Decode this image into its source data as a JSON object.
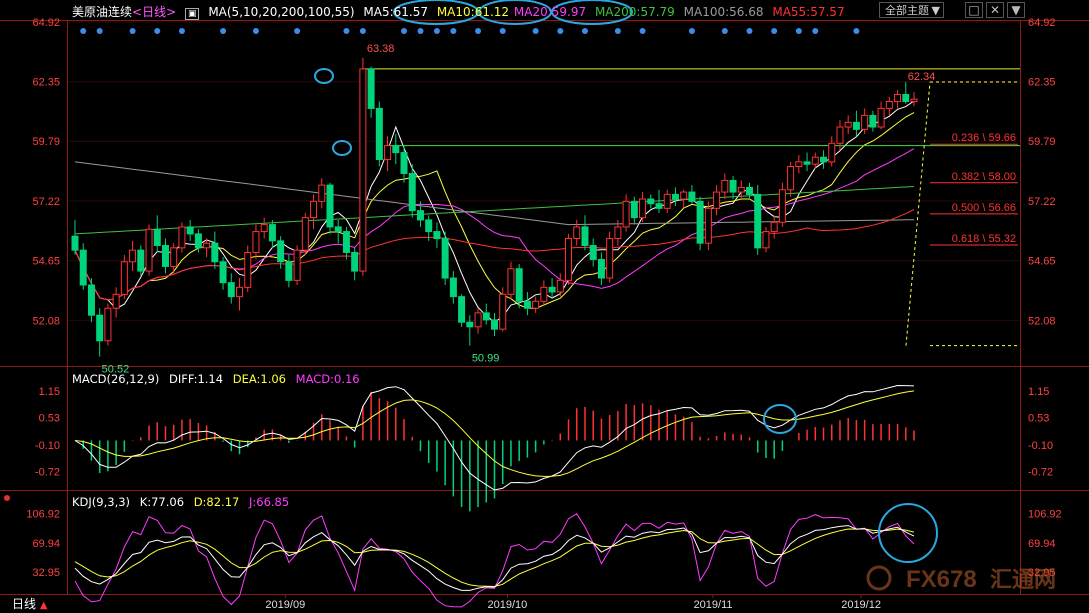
{
  "main_header": {
    "name": "美原油连续",
    "period": "<日线>",
    "ma_params": "MA(5,10,20,200,100,55)",
    "ma5": "MA5:61.57",
    "ma10": "MA10:61.12",
    "ma20": "MA20:59.97",
    "ma200": "MA200:57.79",
    "ma100": "MA100:56.68",
    "ma55": "MA55:57.57"
  },
  "toolbar": {
    "theme_label": "全部主题",
    "theme_arrow": "▼",
    "square_icon": "□",
    "close_icon": "✕",
    "dropdown_icon": "▼"
  },
  "price_axis": [
    "64.92",
    "62.35",
    "59.79",
    "57.22",
    "54.65",
    "52.08"
  ],
  "annotations": {
    "high": "63.38",
    "low1": "50.52",
    "low2": "50.99",
    "recent_high": "62.34"
  },
  "fib_levels": [
    {
      "label": "0.236 \\ 59.66",
      "price": 59.66
    },
    {
      "label": "0.382 \\ 58.00",
      "price": 58.0
    },
    {
      "label": "0.500 \\ 56.66",
      "price": 56.66
    },
    {
      "label": "0.618 \\ 55.32",
      "price": 55.32
    }
  ],
  "macd_header": {
    "params": "MACD(26,12,9)",
    "diff": "DIFF:1.14",
    "dea": "DEA:1.06",
    "macd": "MACD:0.16"
  },
  "macd_axis": [
    "1.15",
    "0.53",
    "-0.10",
    "-0.72"
  ],
  "kdj_header": {
    "params": "KDJ(9,3,3)",
    "k": "K:77.06",
    "d": "D:82.17",
    "j": "J:66.85"
  },
  "kdj_axis": [
    "106.92",
    "69.94",
    "32.95"
  ],
  "date_axis": [
    "2019/09",
    "2019/10",
    "2019/11",
    "2019/12"
  ],
  "bottom_tab": {
    "label": "日线",
    "arrow": "▲"
  },
  "watermark": {
    "text": "FX678",
    "sub": "汇通网"
  },
  "colors": {
    "up": "#ff3232",
    "down": "#00d47a",
    "ma5": "#ffffff",
    "ma10": "#ffff3c",
    "ma20": "#ff3cff",
    "ma200": "#40c040",
    "ma100": "#9a9a9a",
    "ma55": "#ff3232",
    "circle": "#29a8e0"
  },
  "chart_data": {
    "type": "candlestick",
    "title": "美原油连续 <日线>",
    "ylim": [
      50.2,
      64.92
    ],
    "ohlc": [
      [
        55.7,
        56.4,
        54.9,
        55.1
      ],
      [
        55.1,
        55.4,
        53.4,
        53.6
      ],
      [
        53.6,
        53.9,
        52.0,
        52.3
      ],
      [
        52.3,
        52.6,
        50.52,
        51.2
      ],
      [
        51.2,
        52.8,
        51.0,
        52.6
      ],
      [
        52.6,
        53.5,
        52.2,
        53.2
      ],
      [
        53.2,
        54.9,
        53.0,
        54.6
      ],
      [
        54.6,
        55.5,
        54.2,
        55.1
      ],
      [
        55.1,
        55.3,
        54.0,
        54.2
      ],
      [
        54.2,
        56.2,
        54.0,
        56.0
      ],
      [
        56.0,
        56.6,
        55.0,
        55.3
      ],
      [
        55.3,
        55.6,
        54.1,
        54.4
      ],
      [
        54.4,
        55.4,
        54.1,
        55.2
      ],
      [
        55.2,
        56.3,
        55.0,
        56.1
      ],
      [
        56.1,
        56.4,
        55.5,
        55.8
      ],
      [
        55.8,
        56.0,
        55.0,
        55.2
      ],
      [
        55.2,
        55.6,
        54.8,
        55.4
      ],
      [
        55.4,
        55.9,
        54.3,
        54.6
      ],
      [
        54.6,
        54.8,
        53.4,
        53.7
      ],
      [
        53.7,
        54.1,
        52.8,
        53.1
      ],
      [
        53.1,
        53.9,
        52.5,
        53.5
      ],
      [
        53.5,
        55.3,
        53.3,
        55.0
      ],
      [
        55.0,
        56.2,
        54.7,
        55.9
      ],
      [
        55.9,
        56.5,
        55.6,
        56.2
      ],
      [
        56.2,
        56.4,
        55.2,
        55.5
      ],
      [
        55.5,
        55.7,
        54.3,
        54.6
      ],
      [
        54.6,
        54.9,
        53.5,
        53.8
      ],
      [
        53.8,
        55.3,
        53.6,
        55.1
      ],
      [
        55.1,
        56.7,
        54.9,
        56.5
      ],
      [
        56.5,
        57.5,
        56.0,
        57.2
      ],
      [
        57.2,
        58.2,
        56.9,
        57.9
      ],
      [
        57.9,
        58.0,
        55.8,
        56.1
      ],
      [
        56.1,
        56.4,
        55.4,
        55.9
      ],
      [
        55.9,
        56.1,
        54.7,
        55.0
      ],
      [
        55.0,
        55.2,
        53.8,
        54.2
      ],
      [
        54.2,
        63.38,
        54.0,
        62.9
      ],
      [
        62.9,
        63.0,
        60.8,
        61.2
      ],
      [
        61.2,
        61.5,
        58.7,
        59.0
      ],
      [
        59.0,
        60.0,
        58.5,
        59.6
      ],
      [
        59.6,
        60.1,
        58.8,
        59.3
      ],
      [
        59.3,
        59.6,
        58.0,
        58.4
      ],
      [
        58.4,
        58.8,
        56.5,
        56.8
      ],
      [
        56.8,
        57.2,
        56.1,
        56.4
      ],
      [
        56.4,
        56.6,
        55.5,
        55.9
      ],
      [
        55.9,
        56.3,
        55.2,
        55.6
      ],
      [
        55.6,
        55.9,
        53.6,
        53.9
      ],
      [
        53.9,
        54.2,
        52.8,
        53.1
      ],
      [
        53.1,
        53.2,
        51.8,
        52.0
      ],
      [
        52.0,
        52.3,
        50.99,
        51.8
      ],
      [
        51.8,
        52.6,
        51.5,
        52.4
      ],
      [
        52.4,
        52.8,
        51.9,
        52.1
      ],
      [
        52.1,
        52.4,
        51.4,
        51.7
      ],
      [
        51.7,
        53.5,
        51.6,
        53.2
      ],
      [
        53.2,
        54.6,
        53.0,
        54.3
      ],
      [
        54.3,
        54.5,
        52.6,
        52.9
      ],
      [
        52.9,
        53.3,
        52.3,
        52.6
      ],
      [
        52.6,
        53.1,
        52.4,
        52.9
      ],
      [
        52.9,
        53.8,
        52.7,
        53.5
      ],
      [
        53.5,
        53.9,
        53.0,
        53.3
      ],
      [
        53.3,
        54.1,
        53.1,
        53.8
      ],
      [
        53.8,
        55.8,
        53.6,
        55.6
      ],
      [
        55.6,
        56.4,
        55.3,
        56.1
      ],
      [
        56.1,
        56.6,
        55.1,
        55.3
      ],
      [
        55.3,
        55.6,
        54.4,
        54.7
      ],
      [
        54.7,
        55.0,
        53.6,
        53.9
      ],
      [
        53.9,
        55.9,
        53.7,
        55.6
      ],
      [
        55.6,
        56.4,
        55.3,
        56.1
      ],
      [
        56.1,
        57.5,
        55.9,
        57.2
      ],
      [
        57.2,
        57.4,
        56.2,
        56.5
      ],
      [
        56.5,
        57.6,
        56.3,
        57.3
      ],
      [
        57.3,
        57.5,
        56.9,
        57.1
      ],
      [
        57.1,
        57.7,
        56.7,
        56.9
      ],
      [
        56.9,
        57.7,
        56.7,
        57.5
      ],
      [
        57.5,
        57.8,
        57.0,
        57.3
      ],
      [
        57.3,
        57.7,
        56.9,
        57.6
      ],
      [
        57.6,
        57.9,
        57.1,
        57.2
      ],
      [
        57.2,
        57.4,
        55.1,
        55.4
      ],
      [
        55.4,
        57.2,
        55.1,
        56.9
      ],
      [
        56.9,
        57.9,
        56.6,
        57.6
      ],
      [
        57.6,
        58.4,
        57.3,
        58.1
      ],
      [
        58.1,
        58.3,
        57.3,
        57.6
      ],
      [
        57.6,
        58.1,
        57.3,
        57.8
      ],
      [
        57.8,
        58.0,
        57.3,
        57.5
      ],
      [
        57.5,
        57.9,
        54.9,
        55.2
      ],
      [
        55.2,
        56.1,
        55.0,
        55.9
      ],
      [
        55.9,
        56.6,
        55.6,
        56.3
      ],
      [
        56.3,
        58.0,
        56.1,
        57.7
      ],
      [
        57.7,
        58.9,
        57.4,
        58.7
      ],
      [
        58.7,
        59.2,
        58.4,
        58.9
      ],
      [
        58.9,
        59.3,
        58.5,
        58.8
      ],
      [
        58.8,
        59.3,
        58.6,
        59.1
      ],
      [
        59.1,
        59.4,
        58.6,
        58.9
      ],
      [
        58.9,
        60.0,
        58.7,
        59.7
      ],
      [
        59.7,
        60.7,
        59.4,
        60.4
      ],
      [
        60.4,
        60.9,
        60.1,
        60.6
      ],
      [
        60.6,
        61.1,
        60.0,
        60.3
      ],
      [
        60.3,
        61.2,
        60.1,
        60.9
      ],
      [
        60.9,
        61.1,
        60.2,
        60.4
      ],
      [
        60.4,
        61.5,
        60.3,
        61.2
      ],
      [
        61.2,
        61.7,
        60.9,
        61.5
      ],
      [
        61.5,
        62.0,
        61.2,
        61.8
      ],
      [
        61.8,
        62.34,
        61.4,
        61.5
      ],
      [
        61.5,
        61.9,
        61.3,
        61.6
      ]
    ],
    "fib_high": 63.38,
    "fib_low": 50.99,
    "macd_ylim": [
      -1.1,
      1.4
    ],
    "kdj_ylim": [
      10,
      118
    ]
  }
}
